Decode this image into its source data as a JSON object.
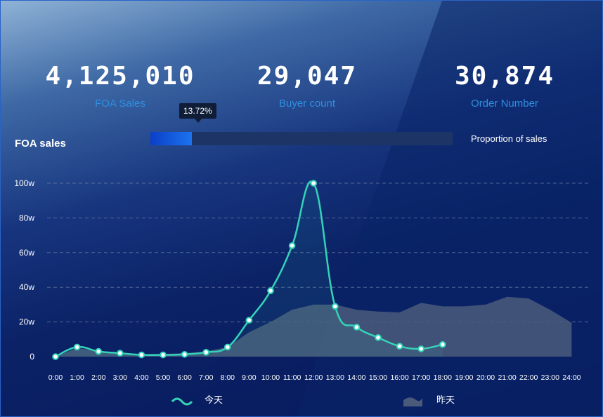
{
  "kpis": [
    {
      "value": "4,125,010",
      "label": "FOA Sales"
    },
    {
      "value": "29,047",
      "label": "Buyer count"
    },
    {
      "value": "30,874",
      "label": "Order Number"
    }
  ],
  "progress": {
    "tooltip": "13.72%",
    "value_percent": 13.72,
    "label": "Proportion of sales"
  },
  "chart_title": "FOA sales",
  "colors": {
    "today_line": "#34d3b9",
    "yesterday_area": "#4a5a7a",
    "grid": "#8090b0"
  },
  "chart_data": {
    "type": "line",
    "title": "FOA sales",
    "y_ticks": [
      "0",
      "20w",
      "40w",
      "60w",
      "80w",
      "100w"
    ],
    "ylim": [
      0,
      100
    ],
    "categories": [
      "0:00",
      "1:00",
      "2:00",
      "3:00",
      "4:00",
      "5:00",
      "6:00",
      "7:00",
      "8:00",
      "9:00",
      "10:00",
      "11:00",
      "12:00",
      "13:00",
      "14:00",
      "15:00",
      "16:00",
      "17:00",
      "18:00",
      "19:00",
      "20:00",
      "21:00",
      "22:00",
      "23:00",
      "24:00"
    ],
    "grid": true,
    "legend_position": "bottom",
    "series": [
      {
        "name": "今天",
        "style": "smooth-line-with-points",
        "values": [
          0,
          5.5,
          3,
          2,
          1,
          1,
          1.3,
          2.5,
          5.5,
          21,
          38,
          64,
          100,
          29,
          17,
          11,
          6,
          4.5,
          7
        ]
      },
      {
        "name": "昨天",
        "style": "area",
        "values": [
          0,
          5,
          3,
          2.2,
          1.5,
          1.5,
          2,
          3,
          5.5,
          14,
          20,
          27,
          30,
          30,
          27,
          26,
          25.5,
          31,
          29,
          29,
          30,
          34.5,
          33.5,
          27,
          19.5
        ]
      }
    ]
  }
}
